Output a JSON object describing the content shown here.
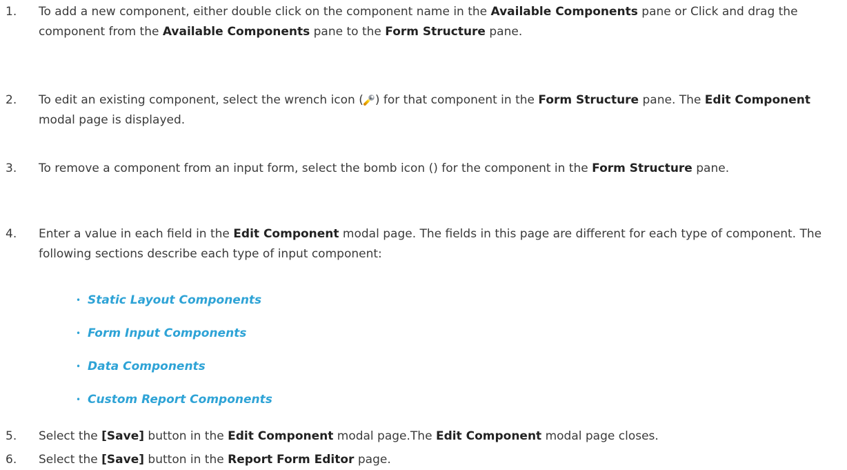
{
  "steps": [
    {
      "num": "1.",
      "t1": "To add a new component, either double click on the component name in the ",
      "b1": "Available Components",
      "t2": " pane or Click and drag the component from the ",
      "b2": "Available Components",
      "t3": " pane to the ",
      "b3": "Form Structure",
      "t4": " pane."
    },
    {
      "num": "2.",
      "t1": "To edit an existing component, select the wrench icon (",
      "t2": ") for that component in the ",
      "b1": "Form Structure",
      "t3": " pane. The ",
      "b2": "Edit Component",
      "t4": " modal page is displayed."
    },
    {
      "num": "3.",
      "t1": "To remove a component from an input form, select the bomb icon () for the component in the ",
      "b1": "Form Structure",
      "t2": " pane."
    },
    {
      "num": "4.",
      "t1": "Enter a value in each field in the ",
      "b1": "Edit Component",
      "t2": " modal page. The fields in this page are different for each type of component. The following sections describe each type of input component:"
    },
    {
      "num": "5.",
      "t1": "Select the ",
      "b1": "[Save]",
      "t2": " button in the ",
      "b2": "Edit Component",
      "t3": " modal page.The ",
      "b3": "Edit Component",
      "t4": " modal page closes."
    },
    {
      "num": "6.",
      "t1": "Select the ",
      "b1": "[Save]",
      "t2": " button in the ",
      "b2": "Report Form Editor",
      "t3": " page."
    }
  ],
  "links": [
    "Static Layout Components",
    "Form Input Components",
    "Data Components",
    "Custom Report Components"
  ],
  "bullet_glyph": "•",
  "icons": {
    "wrench": "wrench-icon"
  },
  "colors": {
    "text": "#3a3a3a",
    "link": "#2ea3d6"
  }
}
